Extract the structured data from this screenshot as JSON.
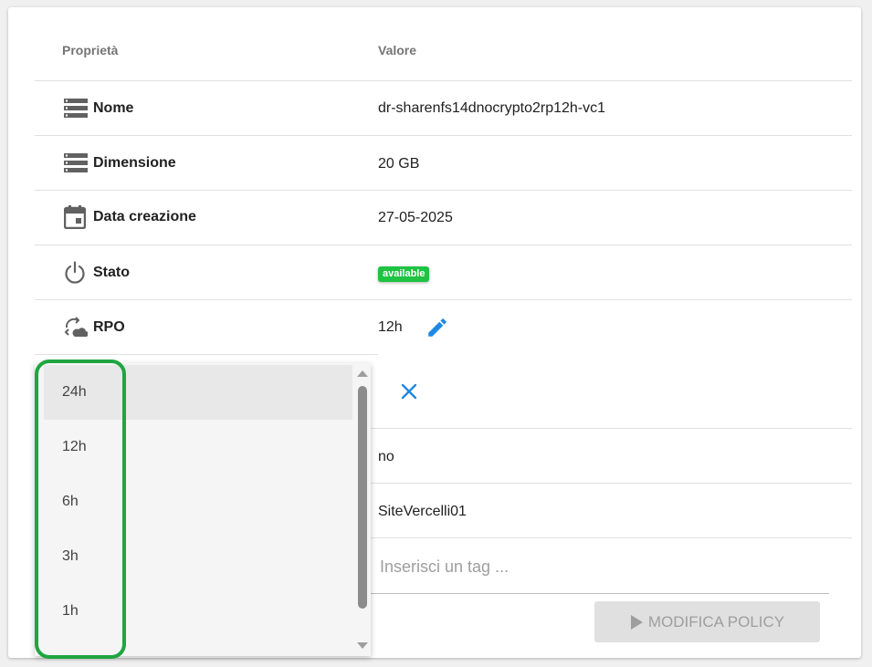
{
  "table": {
    "header_property": "Proprietà",
    "header_value": "Valore",
    "rows": [
      {
        "label": "Nome",
        "value": "dr-sharenfs14dnocrypto2rp12h-vc1",
        "icon": "storage-icon"
      },
      {
        "label": "Dimensione",
        "value": "20 GB",
        "icon": "storage-icon"
      },
      {
        "label": "Data creazione",
        "value": "27-05-2025",
        "icon": "calendar-icon"
      },
      {
        "label": "Stato",
        "value": "available",
        "icon": "power-icon"
      },
      {
        "label": "RPO",
        "value": "12h",
        "icon": "cloud-sync-icon"
      }
    ],
    "extra_values": [
      "no",
      "SiteVercelli01"
    ]
  },
  "tag_input": {
    "placeholder": "Inserisci un tag ..."
  },
  "modify_policy_button": "MODIFICA POLICY",
  "rpo_dropdown": {
    "options": [
      "24h",
      "12h",
      "6h",
      "3h",
      "1h"
    ],
    "selected_index": 0
  },
  "colors": {
    "status_badge": "#1ec341",
    "edit_icon": "#1e88e5",
    "highlight": "#1fa541"
  }
}
